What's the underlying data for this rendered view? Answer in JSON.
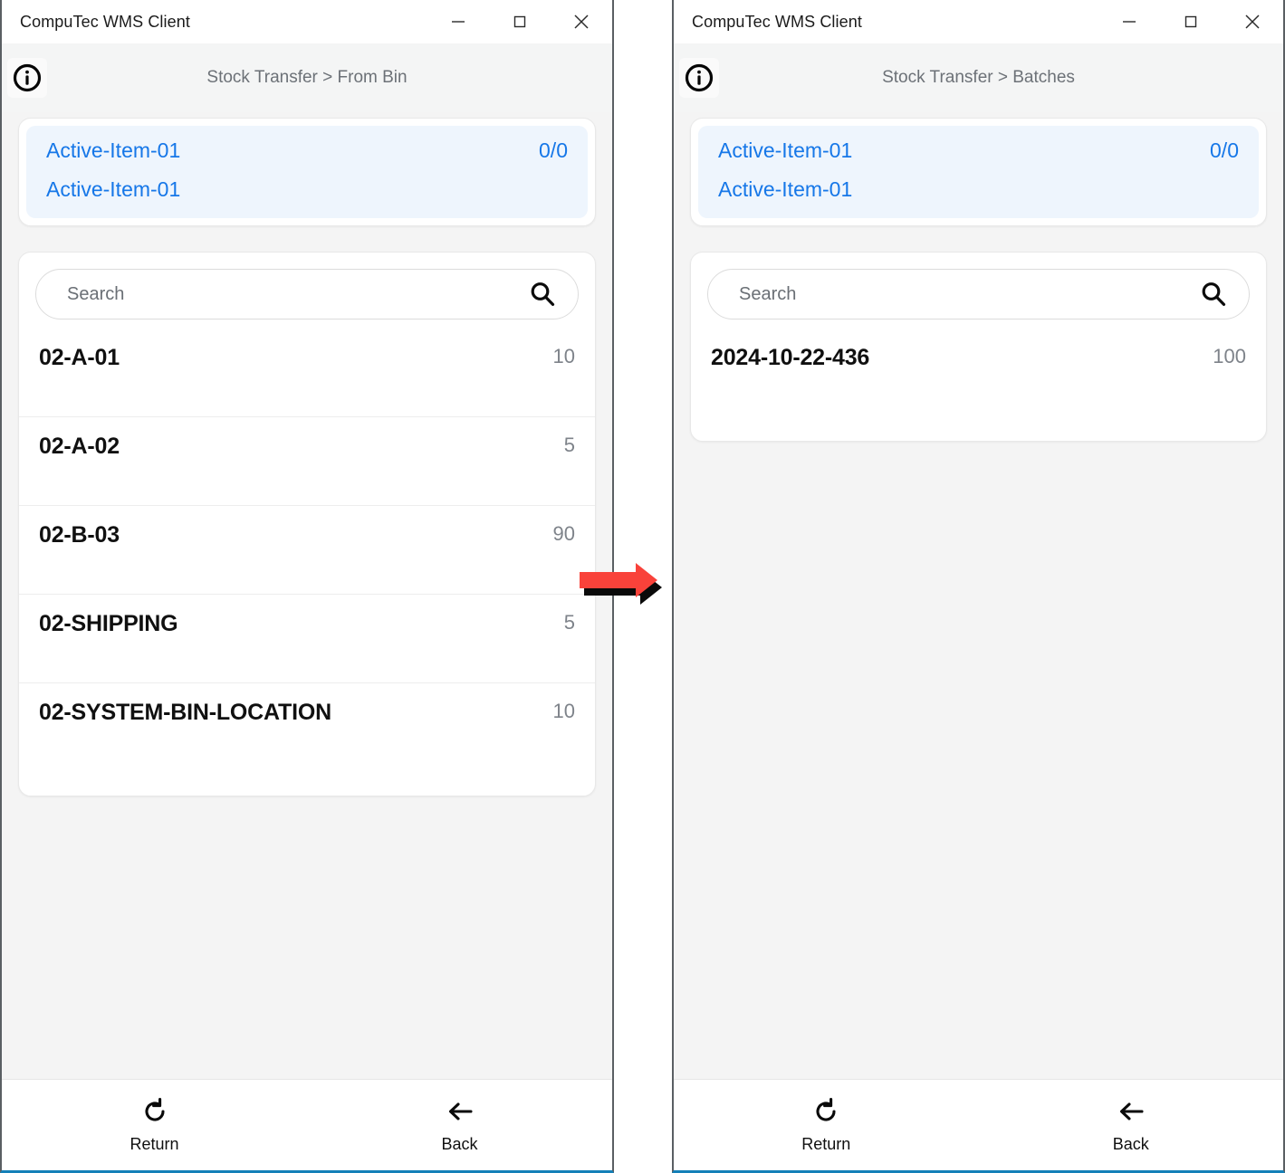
{
  "window": {
    "title": "CompuTec WMS Client",
    "controls": {
      "minimize": "minimize-button",
      "maximize": "maximize-button",
      "close": "close-button"
    },
    "accent_border": "#1480b8"
  },
  "panels": [
    {
      "id": "from-bin",
      "breadcrumb": "Stock Transfer > From Bin",
      "info_icon": "info-icon",
      "item_card": {
        "code": "Active-Item-01",
        "quantity": "0/0",
        "description": "Active-Item-01",
        "accent_color": "#1677e8",
        "background": "#eef5fd"
      },
      "search": {
        "placeholder": "Search",
        "value": "",
        "icon": "search-icon"
      },
      "list": [
        {
          "label": "02-A-01",
          "qty": "10"
        },
        {
          "label": "02-A-02",
          "qty": "5"
        },
        {
          "label": "02-B-03",
          "qty": "90"
        },
        {
          "label": "02-SHIPPING",
          "qty": "5"
        },
        {
          "label": "02-SYSTEM-BIN-LOCATION",
          "qty": "10"
        }
      ],
      "bottom_nav": [
        {
          "label": "Return",
          "icon": "refresh-icon"
        },
        {
          "label": "Back",
          "icon": "arrow-left-icon"
        }
      ]
    },
    {
      "id": "batches",
      "breadcrumb": "Stock Transfer > Batches",
      "info_icon": "info-icon",
      "item_card": {
        "code": "Active-Item-01",
        "quantity": "0/0",
        "description": "Active-Item-01",
        "accent_color": "#1677e8",
        "background": "#eef5fd"
      },
      "search": {
        "placeholder": "Search",
        "value": "",
        "icon": "search-icon"
      },
      "list": [
        {
          "label": "2024-10-22-436",
          "qty": "100"
        }
      ],
      "bottom_nav": [
        {
          "label": "Return",
          "icon": "refresh-icon"
        },
        {
          "label": "Back",
          "icon": "arrow-left-icon"
        }
      ]
    }
  ],
  "annotation": {
    "arrow": {
      "icon": "right-arrow-annotation",
      "color": "#f9423a",
      "outline": "#000000",
      "direction": "right"
    }
  }
}
